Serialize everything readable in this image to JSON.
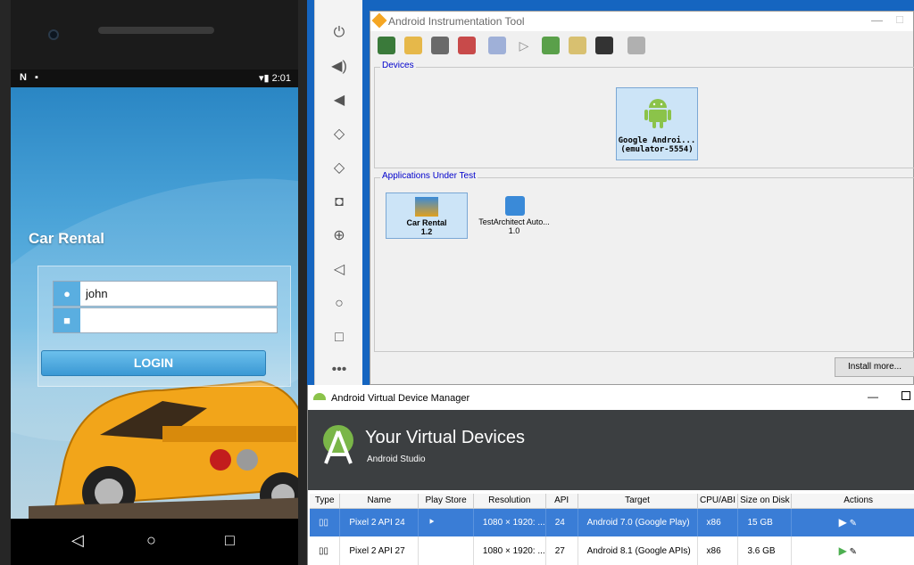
{
  "phone": {
    "status_time": "2:01",
    "app_title": "Car Rental",
    "username_value": "john",
    "password_value": "",
    "login_label": "LOGIN"
  },
  "instrumentation_tool": {
    "title": "Android Instrumentation Tool",
    "devices_label": "Devices",
    "device_name": "Google Androi...",
    "device_id": "(emulator-5554)",
    "apps_label": "Applications Under Test",
    "apps": [
      {
        "name": "Car Rental",
        "version": "1.2"
      },
      {
        "name": "TestArchitect Auto...",
        "version": "1.0"
      }
    ],
    "install_label": "Install more..."
  },
  "avd_manager": {
    "title": "Android Virtual Device Manager",
    "heading": "Your Virtual Devices",
    "subheading": "Android Studio",
    "columns": [
      "Type",
      "Name",
      "Play Store",
      "Resolution",
      "API",
      "Target",
      "CPU/ABI",
      "Size on Disk",
      "Actions"
    ],
    "rows": [
      {
        "name": "Pixel 2 API 24",
        "resolution": "1080 × 1920: ...",
        "api": "24",
        "target": "Android 7.0 (Google Play)",
        "cpu": "x86",
        "size": "15 GB"
      },
      {
        "name": "Pixel 2 API 27",
        "resolution": "1080 × 1920: ...",
        "api": "27",
        "target": "Android 8.1 (Google APIs)",
        "cpu": "x86",
        "size": "3.6 GB"
      }
    ]
  },
  "colors": {
    "selected_row": "#3a7dd6",
    "android_green": "#8bc34a",
    "tile_selected": "#cce4f7"
  }
}
